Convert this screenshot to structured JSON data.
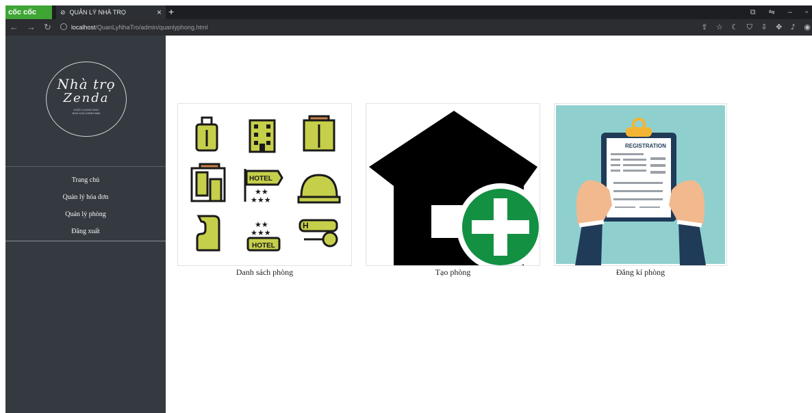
{
  "browser": {
    "brand": "cốc cốc",
    "tab_title": "QUẢN LÝ NHÀ TRỌ",
    "tab_close": "×",
    "new_tab": "+",
    "url_host": "localhost",
    "url_path": "/QuanLyNhaTro/admin/quanlyphong.html"
  },
  "sidebar": {
    "logo": {
      "line1": "Nhà trọ",
      "line2": "Zenda",
      "tagline1": "CHẤT LƯỢNG NHƯ",
      "tagline2": "NHÀ CỦA CHÍNH BẠN"
    },
    "menu": [
      {
        "label": "Trang chủ"
      },
      {
        "label": "Quản lý hóa đơn"
      },
      {
        "label": "Quản lý phòng"
      },
      {
        "label": "Đăng xuất"
      }
    ]
  },
  "cards": [
    {
      "label": "Danh sách phòng",
      "icon": "hotel-icons-grid"
    },
    {
      "label": "Tạo phòng",
      "icon": "house-add-icon"
    },
    {
      "label": "Đăng kí phòng",
      "icon": "registration-clipboard-icon"
    }
  ],
  "illustration_text": {
    "hotel": "HOTEL",
    "h": "H",
    "registration": "REGISTRATION"
  },
  "colors": {
    "sidebar_bg": "#343a40",
    "accent_green": "#149043",
    "hotel_icon_fill": "#c6cf4a",
    "registration_bg": "#8fd0cf"
  }
}
